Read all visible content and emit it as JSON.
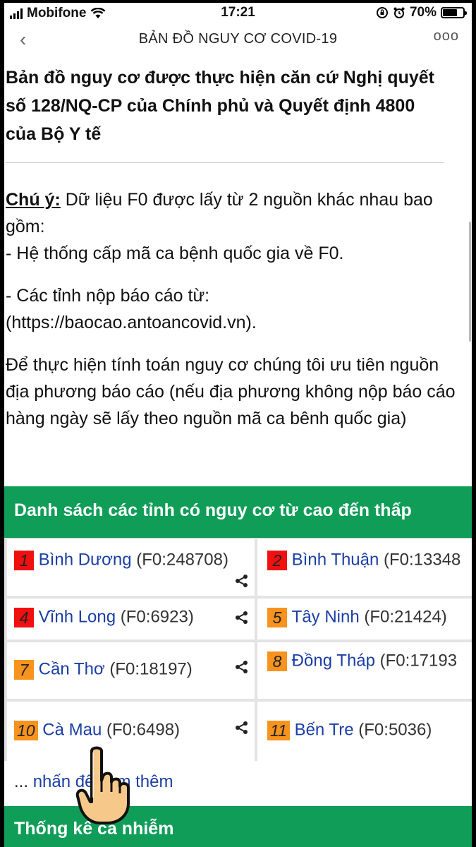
{
  "status_bar": {
    "carrier": "Mobifone",
    "time": "17:21",
    "battery": "70%",
    "battery_level": 0.7
  },
  "nav": {
    "back_icon": "chevron-left-icon",
    "title": "BẢN ĐỒ NGUY CƠ COVID-19",
    "more_label": "ooo"
  },
  "headline": "Bản đồ nguy cơ được thực hiện căn cứ Nghị quyết số 128/NQ-CP của Chính phủ và Quyết định 4800 của Bộ Y tế",
  "note": {
    "label": "Chú ý:",
    "intro": " Dữ liệu F0 được lấy từ 2 nguồn khác nhau bao gồm:",
    "source1": "- Hệ thống cấp mã ca bệnh quốc gia về F0.",
    "source2": "- Các tỉnh nộp báo cáo từ: (https://baocao.antoancovid.vn).",
    "priority": "Để thực hiện tính toán nguy cơ chúng tôi ưu tiên nguồn địa phương báo cáo (nếu địa phương không nộp báo cáo hàng ngày sẽ lấy theo nguồn mã ca bênh quốc gia)"
  },
  "risk_list": {
    "header": "Danh sách các tỉnh có nguy cơ từ cao đến thấp",
    "items": [
      {
        "rank": "1",
        "name": "Bình Dương",
        "f0": "(F0:248708)",
        "level": "red"
      },
      {
        "rank": "2",
        "name": "Bình Thuận",
        "f0": "(F0:13348",
        "level": "red"
      },
      {
        "rank": "4",
        "name": "Vĩnh Long",
        "f0": "(F0:6923)",
        "level": "red"
      },
      {
        "rank": "5",
        "name": "Tây Ninh",
        "f0": "(F0:21424)",
        "level": "orange"
      },
      {
        "rank": "7",
        "name": "Cần Thơ",
        "f0": "(F0:18197)",
        "level": "orange"
      },
      {
        "rank": "8",
        "name": "Đồng Tháp",
        "f0": "(F0:17193",
        "level": "orange"
      },
      {
        "rank": "10",
        "name": "Cà Mau",
        "f0": "(F0:6498)",
        "level": "orange"
      },
      {
        "rank": "11",
        "name": "Bến Tre",
        "f0": "(F0:5036)",
        "level": "orange"
      }
    ],
    "more_dots": "...",
    "more_link": "nhấn để xem thêm"
  },
  "stats": {
    "header": "Thống kê ca nhiễm"
  },
  "colors": {
    "green": "#0f9d58",
    "red": "#f01010",
    "orange": "#f7931e",
    "link": "#1a3ea5"
  }
}
